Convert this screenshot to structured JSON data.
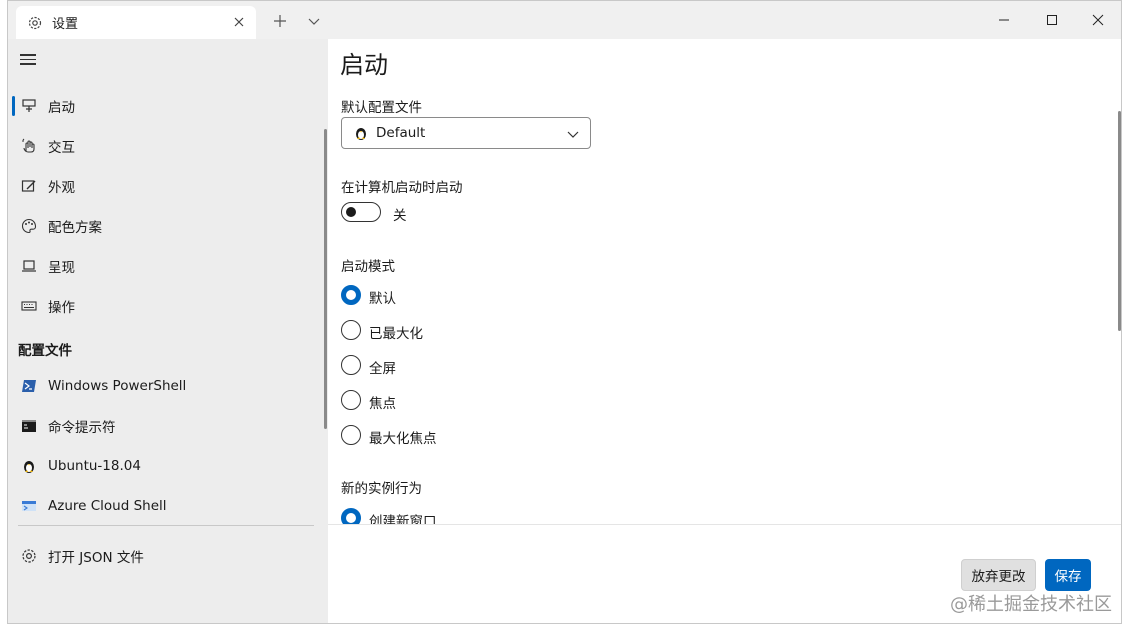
{
  "titlebar": {
    "tab_title": "设置",
    "icons": {
      "tab": "gear-icon",
      "close": "close-icon",
      "new_tab": "plus-icon",
      "dropdown": "chevron-down-icon"
    }
  },
  "sidebar": {
    "items": [
      {
        "label": "启动",
        "icon": "monitor-stand-icon",
        "active": true
      },
      {
        "label": "交互",
        "icon": "hand-pointer-icon"
      },
      {
        "label": "外观",
        "icon": "paint-icon"
      },
      {
        "label": "配色方案",
        "icon": "palette-icon"
      },
      {
        "label": "呈现",
        "icon": "laptop-icon"
      },
      {
        "label": "操作",
        "icon": "keyboard-icon"
      }
    ],
    "profiles_header": "配置文件",
    "profiles": [
      {
        "label": "Windows PowerShell",
        "icon": "powershell-icon",
        "color": "#2b5fab"
      },
      {
        "label": "命令提示符",
        "icon": "cmd-icon",
        "color": "#1b1b1b"
      },
      {
        "label": "Ubuntu-18.04",
        "icon": "linux-penguin-icon"
      },
      {
        "label": "Azure Cloud Shell",
        "icon": "azure-icon",
        "color": "#3a7bd5"
      }
    ],
    "open_json": "打开 JSON 文件"
  },
  "main": {
    "title": "启动",
    "default_profile": {
      "label": "默认配置文件",
      "value": "Default"
    },
    "launch_on_startup": {
      "label": "在计算机启动时启动",
      "state": "关"
    },
    "launch_mode": {
      "label": "启动模式",
      "options": [
        "默认",
        "已最大化",
        "全屏",
        "焦点",
        "最大化焦点"
      ],
      "selected": 0
    },
    "new_instance": {
      "label": "新的实例行为",
      "options": [
        "创建新窗口"
      ],
      "selected": 0
    }
  },
  "footer": {
    "discard": "放弃更改",
    "save": "保存"
  },
  "watermark": "@稀土掘金技术社区",
  "colors": {
    "accent": "#0067c0",
    "sidebar_bg": "#ededed"
  }
}
